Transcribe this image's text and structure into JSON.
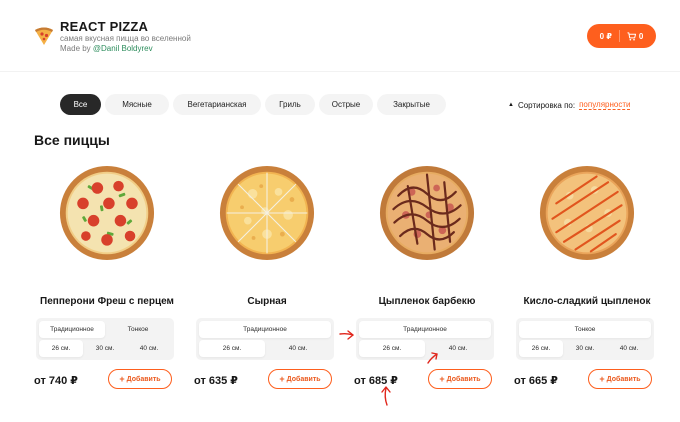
{
  "header": {
    "title": "REACT PIZZA",
    "subtitle": "самая вкусная пицца во вселенной",
    "made_by_prefix": "Made by ",
    "author": "@Danil Boldyrev",
    "logo_icon": "pizza-slice-icon"
  },
  "cart": {
    "price": "0 ₽",
    "count": "0",
    "icon": "cart-icon",
    "accent": "#fe5f1e"
  },
  "categories": [
    {
      "label": "Все",
      "active": true
    },
    {
      "label": "Мясные",
      "active": false
    },
    {
      "label": "Вегетарианская",
      "active": false
    },
    {
      "label": "Гриль",
      "active": false
    },
    {
      "label": "Острые",
      "active": false
    },
    {
      "label": "Закрытые",
      "active": false
    }
  ],
  "sort": {
    "label": "Сортировка по:",
    "value": "популярности"
  },
  "section_title": "Все пиццы",
  "pizzas": [
    {
      "name": "Пепперони Фреш с перцем",
      "types": [
        "Традиционное",
        "Тонкое"
      ],
      "active_type": 0,
      "sizes": [
        "26 см.",
        "30 см.",
        "40 см."
      ],
      "active_size": 0,
      "price": "от 740 ₽",
      "add_label": "Добавить"
    },
    {
      "name": "Сырная",
      "types": [
        "Традиционное"
      ],
      "active_type": 0,
      "sizes": [
        "26 см.",
        "40 см."
      ],
      "active_size": 0,
      "price": "от 635 ₽",
      "add_label": "Добавить"
    },
    {
      "name": "Цыпленок барбекю",
      "types": [
        "Традиционное"
      ],
      "active_type": 0,
      "sizes": [
        "26 см.",
        "40 см."
      ],
      "active_size": 0,
      "price": "от 685 ₽",
      "add_label": "Добавить"
    },
    {
      "name": "Кисло-сладкий цыпленок",
      "types": [
        "Тонкое"
      ],
      "active_type": 0,
      "sizes": [
        "26 см.",
        "30 см.",
        "40 см."
      ],
      "active_size": 0,
      "price": "от 665 ₽",
      "add_label": "Добавить"
    }
  ]
}
